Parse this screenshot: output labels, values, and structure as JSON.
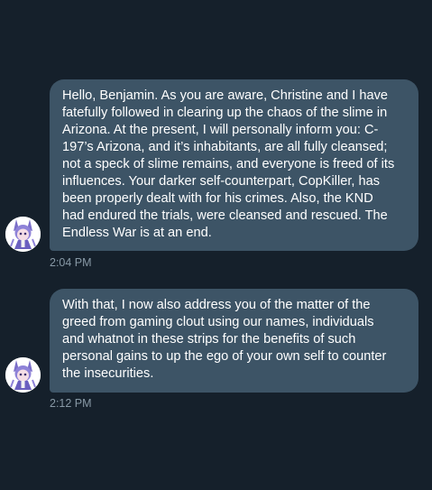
{
  "theme": {
    "background": "#15202b",
    "bubble": "#3d5466",
    "text": "#ffffff",
    "timestamp": "#8899a6"
  },
  "messages": [
    {
      "avatar_icon": "anime-character-avatar-icon",
      "lines": [
        "Hello, Benjamin.  As you are aware, Christine and I have",
        "fatefully followed in clearing up the chaos of the slime in",
        "Arizona.  At the present, I will personally inform you: C-",
        "197’s Arizona, and it’s inhabitants, are all fully cleansed;",
        "not a speck of slime remains, and everyone is freed of its",
        "influences.  Your darker self-counterpart, CopKiller, has",
        "been properly dealt with for his crimes.  Also, the KND",
        "had endured the trials, were cleansed and rescued.  The",
        "Endless War is at an end."
      ],
      "timestamp": "2:04 PM"
    },
    {
      "avatar_icon": "anime-character-avatar-icon",
      "lines": [
        "With that, I now also address you of the matter of the",
        "greed from gaming clout using our names, individuals",
        "and whatnot in these strips for the benefits of such",
        "personal gains to up the ego of your own self to counter",
        "the insecurities."
      ],
      "timestamp": "2:12 PM"
    }
  ]
}
